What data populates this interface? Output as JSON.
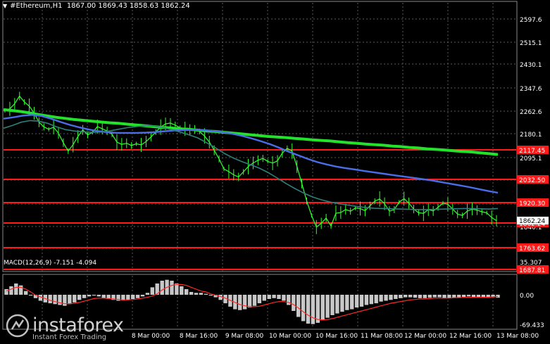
{
  "header": {
    "symbol_timeframe": "#Ethereum,H1",
    "ohlc": "1867.00 1869.43 1858.63 1862.24"
  },
  "indicator_label": "MACD(12,26,9) -7.151 -4.094",
  "watermark": {
    "brand": "instaforex",
    "tagline": "Instant Forex Trading"
  },
  "chart_data": [
    {
      "type": "line",
      "title": "#Ethereum,H1",
      "y_axis_ticks": [
        2597.6,
        2515.1,
        2430.1,
        2347.6,
        2262.6,
        2180.1,
        2095.1,
        2010.1,
        1925.1,
        1840.1,
        1757.6
      ],
      "ylim": [
        1735,
        2660
      ],
      "x_tick_labels": [
        "8 Mar 00:00",
        "8 Mar 16:00",
        "9 Mar 08:00",
        "10 Mar 00:00",
        "10 Mar 16:00",
        "11 Mar 08:00",
        "12 Mar 00:00",
        "12 Mar 16:00",
        "13 Mar 08:00"
      ],
      "horizontal_levels": [
        {
          "label": "2117.45",
          "value": 2117.45
        },
        {
          "label": "2032.50",
          "value": 2032.5
        },
        {
          "label": "1920.30",
          "value": 1920.3
        },
        {
          "label": "1862.24",
          "value": 1862.24
        },
        {
          "label": "1763.62",
          "value": 1763.62
        },
        {
          "label": "1687.81",
          "value": 1687.81
        }
      ],
      "current_price": "1862.24",
      "price_series": [
        2265,
        2271,
        2290,
        2318,
        2296,
        2281,
        2255,
        2222,
        2205,
        2196,
        2204,
        2182,
        2148,
        2118,
        2141,
        2170,
        2194,
        2176,
        2185,
        2206,
        2198,
        2190,
        2178,
        2150,
        2142,
        2146,
        2138,
        2144,
        2140,
        2152,
        2168,
        2186,
        2204,
        2216,
        2219,
        2211,
        2202,
        2198,
        2194,
        2196,
        2188,
        2172,
        2150,
        2121,
        2090,
        2052,
        2042,
        2030,
        2022,
        2041,
        2061,
        2075,
        2085,
        2092,
        2081,
        2074,
        2083,
        2111,
        2128,
        2118,
        2061,
        1998,
        1936,
        1882,
        1838,
        1852,
        1872,
        1842,
        1890,
        1893,
        1904,
        1898,
        1910,
        1908,
        1900,
        1918,
        1935,
        1943,
        1926,
        1898,
        1904,
        1932,
        1944,
        1928,
        1906,
        1892,
        1890,
        1904,
        1899,
        1913,
        1928,
        1924,
        1906,
        1887,
        1882,
        1898,
        1906,
        1902,
        1896,
        1892,
        1874,
        1862
      ],
      "moving_averages": [
        {
          "color": "#22e32a",
          "values": [
            2268,
            2265,
            2261,
            2256,
            2250,
            2245,
            2240,
            2236,
            2232,
            2229,
            2226,
            2223,
            2220,
            2218,
            2215,
            2212,
            2209,
            2206,
            2203,
            2201,
            2198,
            2196,
            2193,
            2190,
            2188,
            2185,
            2182,
            2179,
            2176,
            2173,
            2170,
            2168,
            2166,
            2163,
            2161,
            2158,
            2156,
            2154,
            2151,
            2148,
            2146,
            2143,
            2141,
            2139,
            2136,
            2134,
            2131,
            2129,
            2126,
            2124,
            2122,
            2119,
            2117,
            2115,
            2112,
            2109,
            2106
          ]
        },
        {
          "color": "#4a6ee8",
          "values": [
            2235,
            2240,
            2246,
            2249,
            2245,
            2235,
            2223,
            2212,
            2203,
            2195,
            2189,
            2185,
            2183,
            2183,
            2183,
            2184,
            2186,
            2189,
            2192,
            2193,
            2194,
            2193,
            2190,
            2186,
            2180,
            2173,
            2164,
            2154,
            2143,
            2130,
            2116,
            2103,
            2090,
            2078,
            2069,
            2061,
            2055,
            2050,
            2044,
            2039,
            2034,
            2029,
            2024,
            2019,
            2014,
            2009,
            2003,
            1997,
            1991,
            1985,
            1978,
            1971,
            1965
          ]
        },
        {
          "color": "#2f7f7a",
          "values": [
            2200,
            2210,
            2222,
            2228,
            2226,
            2218,
            2205,
            2195,
            2190,
            2187,
            2185,
            2186,
            2190,
            2196,
            2202,
            2206,
            2209,
            2208,
            2203,
            2195,
            2186,
            2176,
            2165,
            2148,
            2130,
            2110,
            2094,
            2080,
            2068,
            2055,
            2038,
            2018,
            1998,
            1980,
            1964,
            1950,
            1940,
            1932,
            1926,
            1921,
            1916,
            1912,
            1909,
            1908,
            1907,
            1906,
            1905,
            1904,
            1904,
            1905,
            1906,
            1907,
            1908,
            1908,
            1907,
            1906,
            1908
          ]
        }
      ]
    },
    {
      "type": "bar",
      "title": "MACD(12,26,9) -7.151 -4.094",
      "y_axis_ticks": [
        35.307,
        0.0,
        -69.433
      ],
      "ylim": [
        -72,
        40
      ],
      "histogram": [
        6,
        9,
        12,
        10,
        4,
        -2,
        -8,
        -14,
        -18,
        -20,
        -22,
        -24,
        -26,
        -22,
        -18,
        -12,
        -8,
        -4,
        -2,
        -4,
        -8,
        -10,
        -12,
        -14,
        -13,
        -12,
        -10,
        -8,
        -4,
        2,
        8,
        12,
        15,
        16,
        15,
        12,
        9,
        6,
        3,
        2,
        2,
        1,
        -2,
        -6,
        -12,
        -20,
        -28,
        -34,
        -36,
        -34,
        -30,
        -26,
        -20,
        -14,
        -10,
        -8,
        -10,
        -14,
        -24,
        -38,
        -52,
        -62,
        -68,
        -69,
        -66,
        -60,
        -54,
        -48,
        -44,
        -40,
        -36,
        -34,
        -30,
        -28,
        -24,
        -22,
        -20,
        -16,
        -14,
        -12,
        -10,
        -8,
        -6,
        -6,
        -7,
        -8,
        -8,
        -7,
        -6,
        -6,
        -8,
        -8,
        -7,
        -6,
        -5,
        -4,
        -5,
        -6,
        -7,
        -7,
        -6,
        -7
      ],
      "signal": [
        4,
        6,
        8,
        8,
        6,
        3,
        -1,
        -5,
        -9,
        -13,
        -16,
        -19,
        -21,
        -21,
        -20,
        -18,
        -15,
        -12,
        -9,
        -8,
        -8,
        -9,
        -10,
        -11,
        -12,
        -12,
        -11,
        -10,
        -8,
        -6,
        -3,
        1,
        5,
        8,
        10,
        11,
        11,
        10,
        8,
        6,
        4,
        3,
        1,
        -1,
        -4,
        -8,
        -13,
        -18,
        -23,
        -26,
        -28,
        -28,
        -27,
        -24,
        -21,
        -18,
        -16,
        -16,
        -18,
        -23,
        -31,
        -40,
        -48,
        -54,
        -58,
        -59,
        -58,
        -56,
        -53,
        -50,
        -47,
        -44,
        -41,
        -38,
        -35,
        -32,
        -29,
        -26,
        -23,
        -20,
        -18,
        -16,
        -14,
        -12,
        -11,
        -10,
        -10,
        -9,
        -8,
        -8,
        -8,
        -8,
        -7,
        -7,
        -6,
        -6,
        -6,
        -6,
        -6,
        -6,
        -5,
        -4.1
      ]
    }
  ]
}
